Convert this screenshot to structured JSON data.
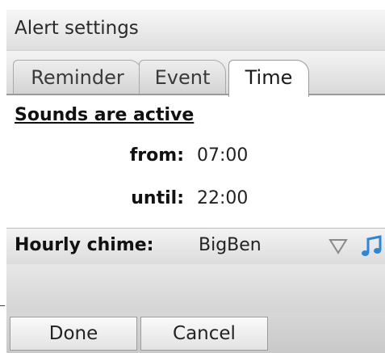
{
  "window": {
    "title": "Alert settings"
  },
  "tabs": [
    {
      "label": "Reminder",
      "active": false
    },
    {
      "label": "Event",
      "active": false
    },
    {
      "label": "Time",
      "active": true
    }
  ],
  "time_panel": {
    "heading": "Sounds are active",
    "from_label": "from:",
    "from_value": "07:00",
    "until_label": "until:",
    "until_value": "22:00"
  },
  "chime": {
    "label": "Hourly chime:",
    "value": "BigBen",
    "dropdown_icon": "dropdown-triangle-icon",
    "sound_icon": "music-note-icon"
  },
  "softkeys": {
    "done_label": "Done",
    "cancel_label": "Cancel"
  },
  "colors": {
    "accent_icon": "#2f86d6",
    "panel_gray": "#dcdcdc",
    "text": "#111111"
  }
}
